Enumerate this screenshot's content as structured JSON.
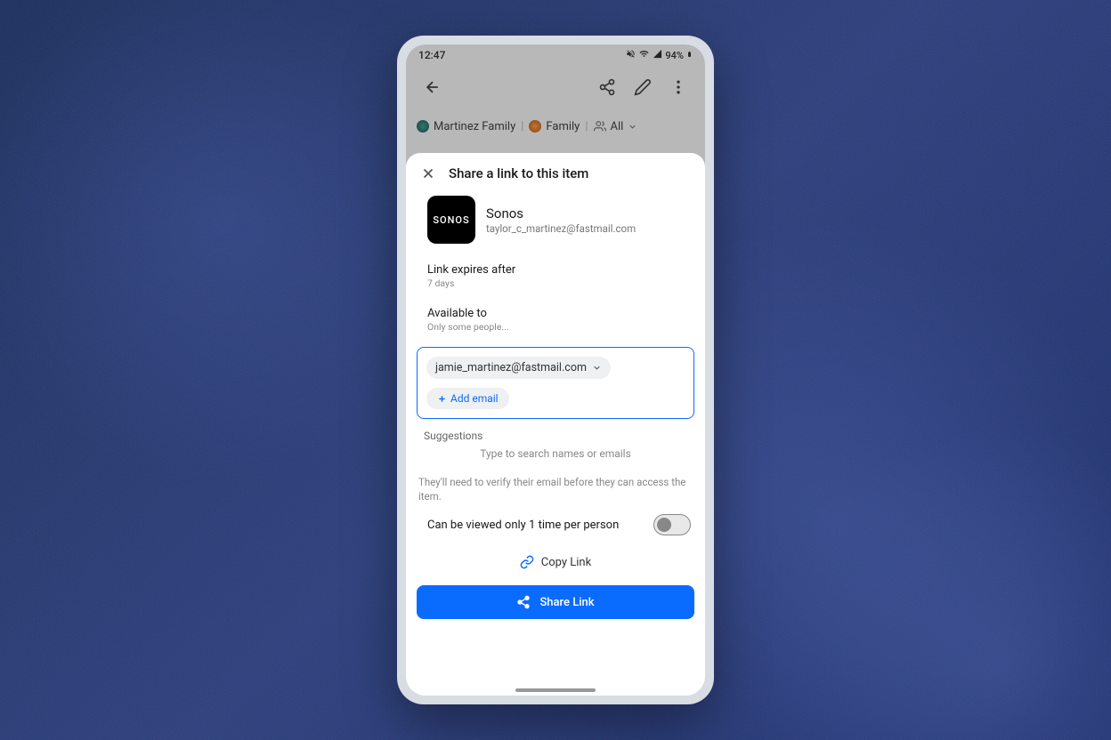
{
  "status": {
    "time": "12:47",
    "battery": "94%"
  },
  "toolbar": {
    "crumb1": "Martinez Family",
    "crumb2": "Family",
    "crumb3": "All"
  },
  "sheet": {
    "title": "Share a link to this item",
    "item": {
      "name": "Sonos",
      "logo_text": "SONOS",
      "email": "taylor_c_martinez@fastmail.com"
    },
    "expires_label": "Link expires after",
    "expires_value": "7 days",
    "available_label": "Available to",
    "available_value": "Only some people...",
    "chip_email": "jamie_martinez@fastmail.com",
    "add_email": "Add email",
    "suggestions_label": "Suggestions",
    "suggestions_hint": "Type to search names or emails",
    "verify_note": "They'll need to verify their email before they can access the item.",
    "toggle_label": "Can be viewed only 1 time per person",
    "copy_link": "Copy Link",
    "share_button": "Share Link"
  }
}
